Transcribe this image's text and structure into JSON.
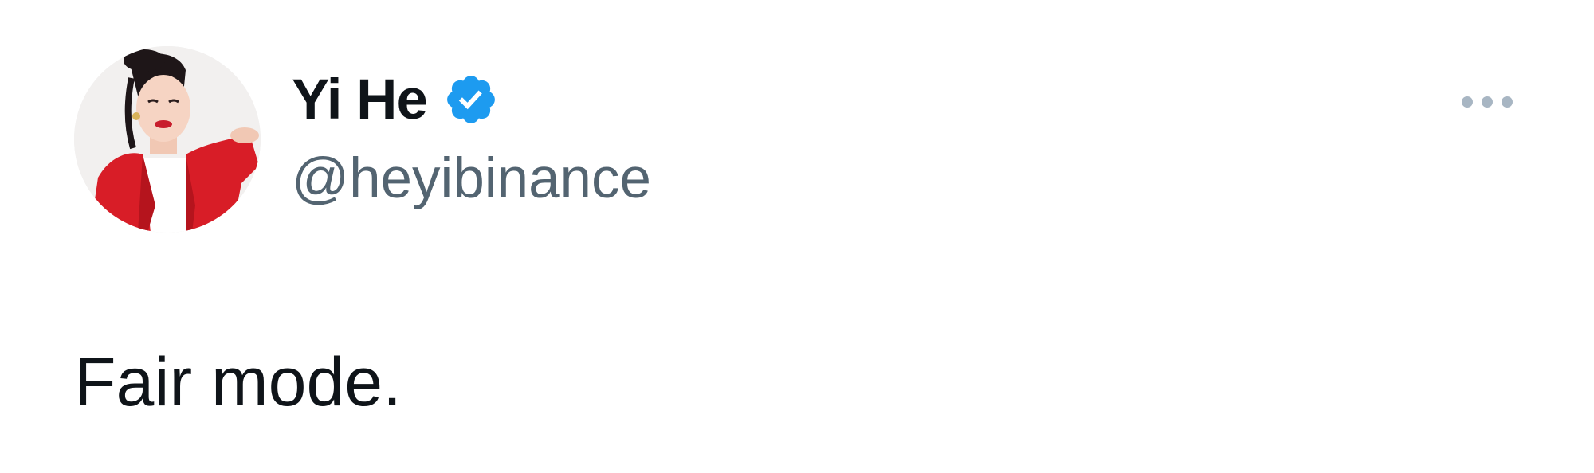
{
  "tweet": {
    "author": {
      "display_name": "Yi He",
      "handle": "@heyibinance",
      "verified": true,
      "avatar_icon": "profile-photo"
    },
    "text": "Fair mode.",
    "menu_icon": "more-options-icon"
  },
  "colors": {
    "background": "#ffffff",
    "text_primary": "#0f1419",
    "text_secondary": "#536471",
    "verified_badge": "#1d9bf0",
    "menu_dots": "#a8b6c3"
  }
}
